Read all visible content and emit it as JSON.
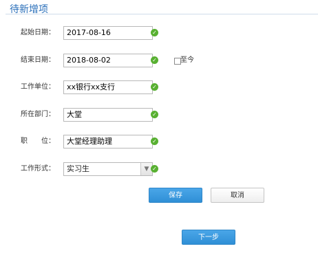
{
  "header": {
    "title": "待新增项"
  },
  "form": {
    "start_date": {
      "label": "起始日期：",
      "value": "2017-08-16"
    },
    "end_date": {
      "label": "结束日期：",
      "value": "2018-08-02",
      "until_now_label": "至今"
    },
    "employer": {
      "label": "工作单位：",
      "value": "xx银行xx支行"
    },
    "department": {
      "label": "所在部门：",
      "value": "大堂"
    },
    "position": {
      "label": "职　　位：",
      "value": "大堂经理助理"
    },
    "work_type": {
      "label": "工作形式：",
      "value": "实习生"
    }
  },
  "actions": {
    "save_label": "保存",
    "cancel_label": "取消",
    "next_label": "下一步"
  },
  "colors": {
    "accent": "#2f8fd6",
    "valid": "#58b031",
    "title": "#2a6fba"
  },
  "icons": {
    "valid": "check-circle-icon",
    "dropdown": "chevron-down-icon"
  }
}
